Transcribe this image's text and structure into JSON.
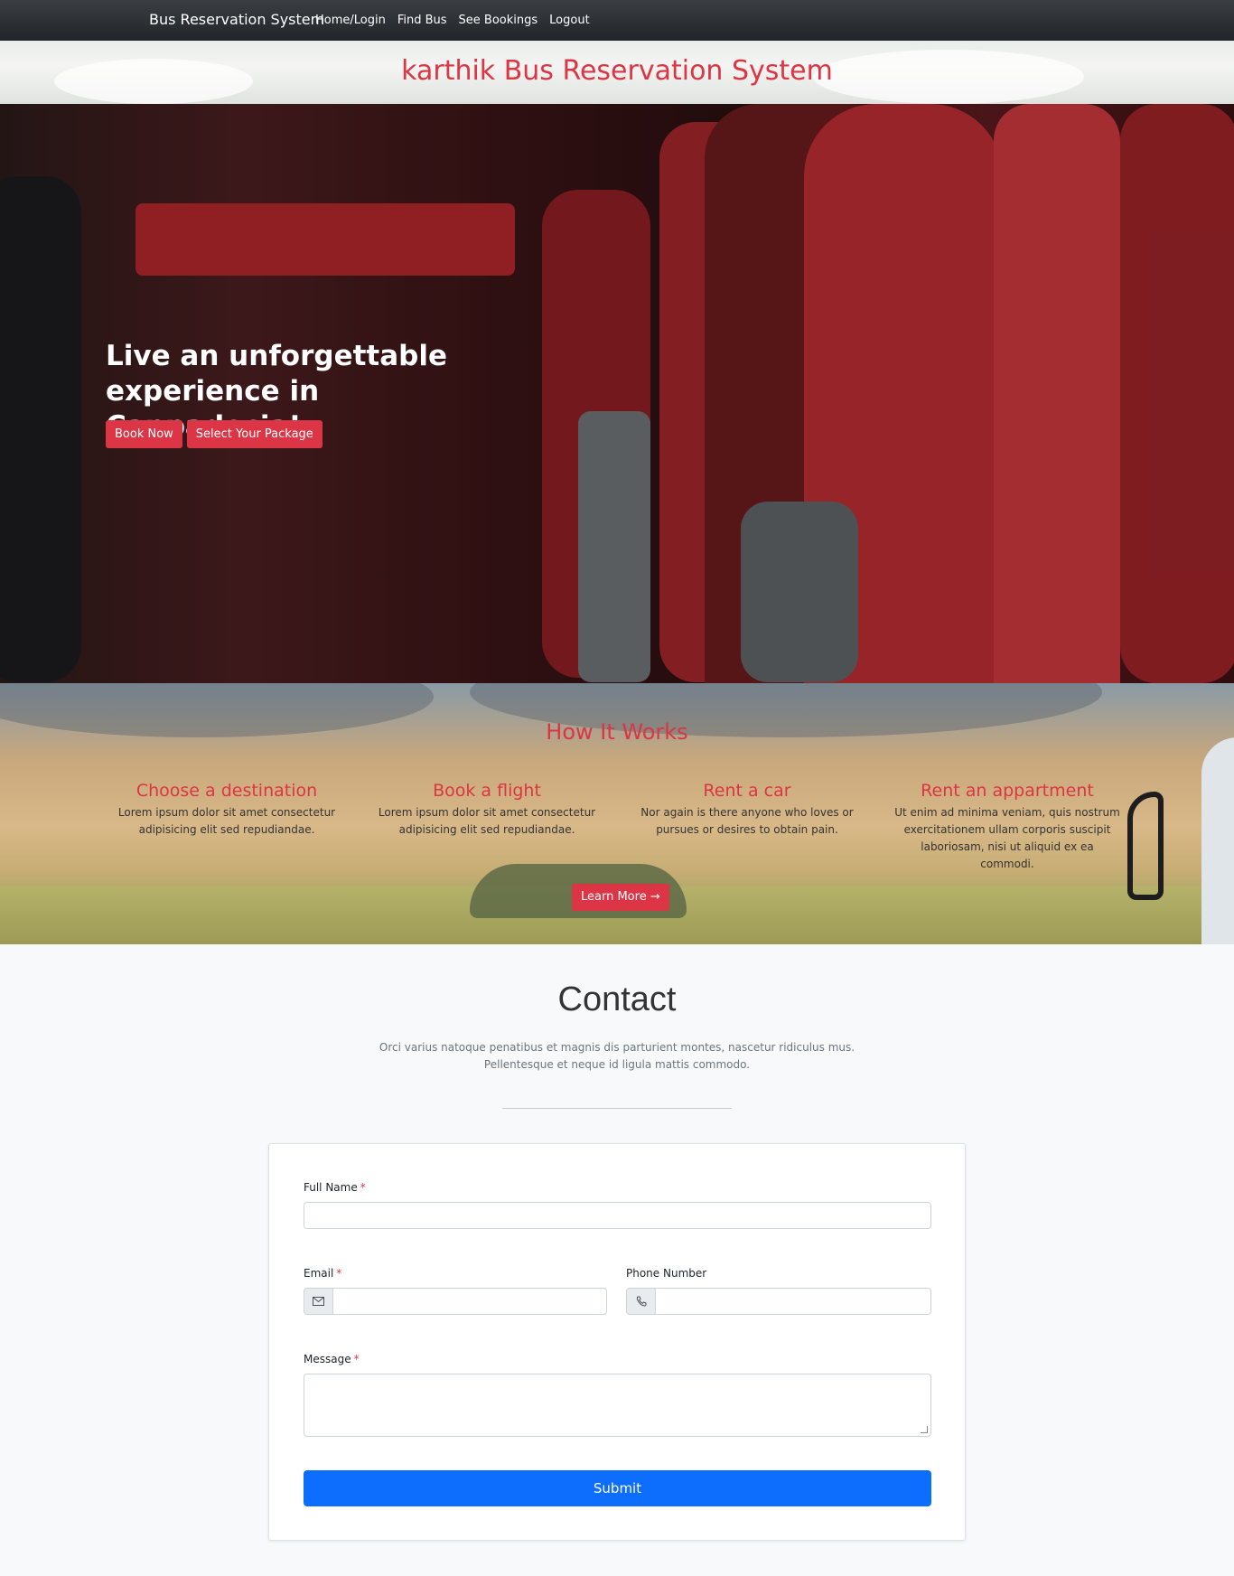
{
  "navbar": {
    "brand": "Bus Reservation System",
    "links": [
      "Home/Login",
      "Find Bus",
      "See Bookings",
      "Logout"
    ]
  },
  "site_title": "karthik Bus Reservation System",
  "hero": {
    "heading": "Live an unforgettable experience in Cappadocia!",
    "buttons": [
      "Book Now",
      "Select Your Package"
    ]
  },
  "how": {
    "title": "How It Works",
    "steps": [
      {
        "title": "Choose a destination",
        "text": "Lorem ipsum dolor sit amet consectetur adipisicing elit sed repudiandae."
      },
      {
        "title": "Book a flight",
        "text": "Lorem ipsum dolor sit amet consectetur adipisicing elit sed repudiandae."
      },
      {
        "title": "Rent a car",
        "text": "Nor again is there anyone who loves or pursues or desires to obtain pain."
      },
      {
        "title": "Rent an appartment",
        "text": "Ut enim ad minima veniam, quis nostrum exercitationem ullam corporis suscipit laboriosam, nisi ut aliquid ex ea commodi."
      }
    ],
    "learn_more": "Learn More →"
  },
  "contact": {
    "title": "Contact",
    "subtitle_line1": "Orci varius natoque penatibus et magnis dis parturient montes, nascetur ridiculus mus.",
    "subtitle_line2": "Pellentesque et neque id ligula mattis commodo.",
    "form": {
      "full_name_label": "Full Name",
      "email_label": "Email",
      "phone_label": "Phone Number",
      "message_label": "Message",
      "required_mark": "*",
      "submit": "Submit"
    }
  },
  "colors": {
    "accent": "#dc3545",
    "primary": "#0d6efd",
    "navbar": "#212529"
  }
}
